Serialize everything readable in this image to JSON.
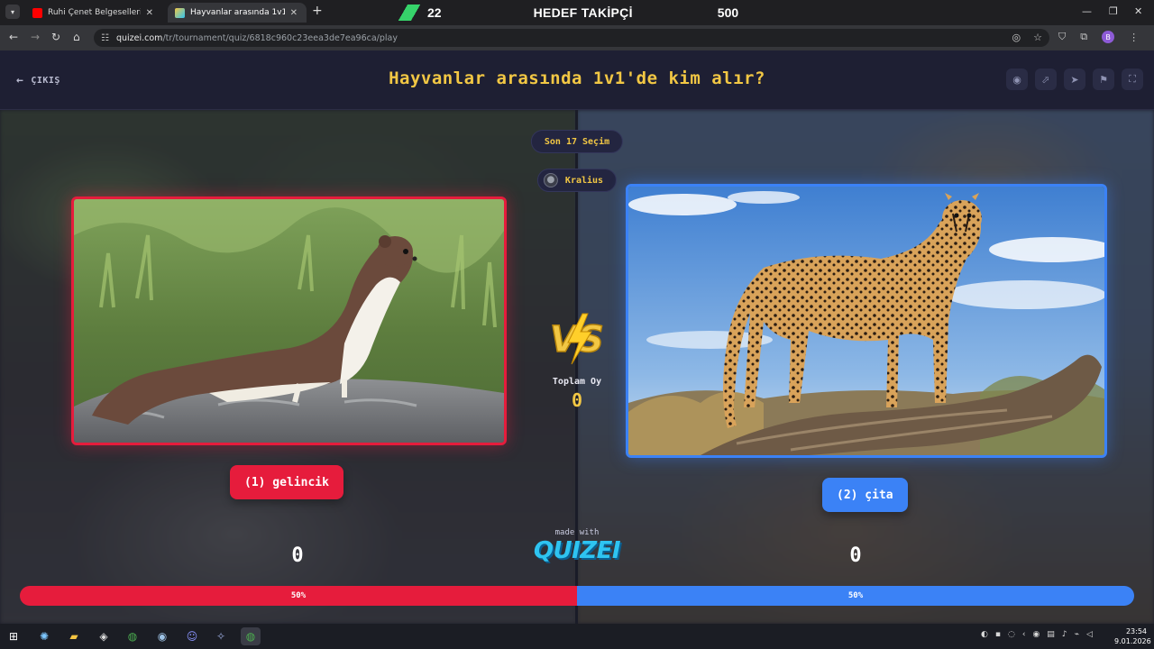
{
  "browser": {
    "tabs": [
      {
        "title": "Ruhi Çenet Belgeselleri - YouTube",
        "active": false,
        "favicon_color": "#ff0000"
      },
      {
        "title": "Hayvanlar arasında 1v1'de kim alır?",
        "active": true,
        "favicon_color": "#f2c744"
      }
    ],
    "new_tab_label": "+",
    "url_host": "quizei.com",
    "url_path": "/tr/tournament/quiz/6818c960c23eea3de7ea96ca/play",
    "profile_initial": "B"
  },
  "stream_overlay": {
    "count": "22",
    "label": "HEDEF TAKİPÇİ",
    "target": "500"
  },
  "quiz": {
    "exit_label": "ÇIKIŞ",
    "title": "Hayvanlar arasında 1v1'de kim alır?",
    "toolbar_icons": [
      "eye-icon",
      "share-icon",
      "send-icon",
      "flag-icon",
      "fullscreen-icon"
    ],
    "recent_label": "Son 17 Seçim",
    "creator_name": "Kralius",
    "vs_label": "VS",
    "total_votes_label": "Toplam Oy",
    "total_votes": "0",
    "left": {
      "label": "(1) gelincik",
      "score": "0",
      "percent_label": "50%",
      "percent": 50,
      "accent": "#e61c3c"
    },
    "right": {
      "label": "(2) çita",
      "score": "0",
      "percent_label": "50%",
      "percent": 50,
      "accent": "#3b82f6"
    },
    "made_with": "made with",
    "brand": "QUIZEI"
  },
  "taskbar": {
    "apps": [
      "windows-start-icon",
      "copilot-icon",
      "file-explorer-icon",
      "app-icon",
      "chrome-icon",
      "steam-icon",
      "discord-icon",
      "app-icon-2",
      "chrome-active-icon"
    ],
    "time": "23:54",
    "date": "9.01.2026"
  }
}
